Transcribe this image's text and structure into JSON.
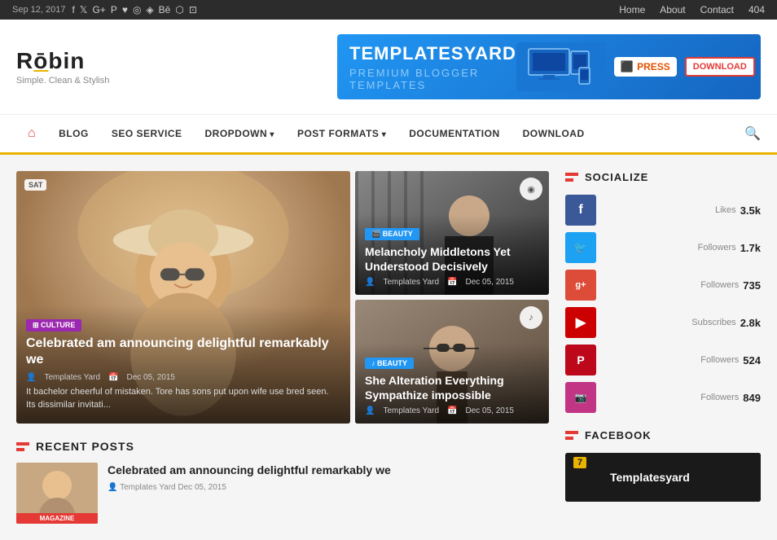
{
  "topbar": {
    "date": "Sep 12, 2017",
    "nav": {
      "home": "Home",
      "about": "About",
      "contact": "Contact",
      "404": "404"
    }
  },
  "header": {
    "logo": "Robin",
    "logo_underline_char": "o",
    "tagline": "Simple. Clean & Stylish",
    "banner": {
      "brand": "TEMPLATESYARD",
      "sub": "PREMIUM BLOGGER TEMPLATES",
      "press": "PRESS",
      "download": "DOWNLOAD"
    }
  },
  "nav": {
    "home_icon": "⌂",
    "items": [
      {
        "label": "BLOG",
        "has_dropdown": false
      },
      {
        "label": "SEO SERVICE",
        "has_dropdown": false
      },
      {
        "label": "DROPDOWN",
        "has_dropdown": true
      },
      {
        "label": "POST FORMATS",
        "has_dropdown": true
      },
      {
        "label": "DOCUMENTATION",
        "has_dropdown": false
      },
      {
        "label": "DOWNLOAD",
        "has_dropdown": false
      }
    ]
  },
  "featured": {
    "main": {
      "corner_tag": "SAT",
      "category": "CULTURE",
      "title": "Celebrated am announcing delightful remarkably we",
      "author": "Templates Yard",
      "date": "Dec 05, 2015",
      "excerpt": "It bachelor cheerful of mistaken. Tore has sons put upon wife use bred seen. Its dissimilar invitati..."
    },
    "side_top": {
      "corner_icon": "◉",
      "category": "BEAUTY",
      "category_class": "badge-beauty",
      "title": "Melancholy Middletons Yet Understood Decisively",
      "author": "Templates Yard",
      "date": "Dec 05, 2015"
    },
    "side_bottom": {
      "corner_icon": "♪",
      "category": "BEAUTY",
      "category_class": "badge-beauty",
      "title": "She Alteration Everything Sympathize impossible",
      "author": "Templates Yard",
      "date": "Dec 05, 2015"
    }
  },
  "recent_posts": {
    "section_title": "RECENT POSTS",
    "thumb_badge": "MAGAZINE",
    "post_title": "Celebrated am announcing delightful remarkably we",
    "post_meta": "Templates Yard   Dec 05, 2015"
  },
  "sidebar": {
    "socialize": {
      "title": "SOCIALIZE",
      "items": [
        {
          "platform": "facebook",
          "icon": "f",
          "class": "social-fb",
          "label": "Likes",
          "count": "3.5k"
        },
        {
          "platform": "twitter",
          "icon": "t",
          "class": "social-tw",
          "label": "Followers",
          "count": "1.7k"
        },
        {
          "platform": "googleplus",
          "icon": "g+",
          "class": "social-gp",
          "label": "Followers",
          "count": "735"
        },
        {
          "platform": "youtube",
          "icon": "▶",
          "class": "social-yt",
          "label": "Subscribes",
          "count": "2.8k"
        },
        {
          "platform": "pinterest",
          "icon": "P",
          "class": "social-pi",
          "label": "Followers",
          "count": "524"
        },
        {
          "platform": "instagram",
          "icon": "📷",
          "class": "social-ig",
          "label": "Followers",
          "count": "849"
        }
      ]
    },
    "facebook": {
      "title": "FACEBOOK",
      "preview_number": "7",
      "preview_text": "Templatesyard"
    }
  }
}
